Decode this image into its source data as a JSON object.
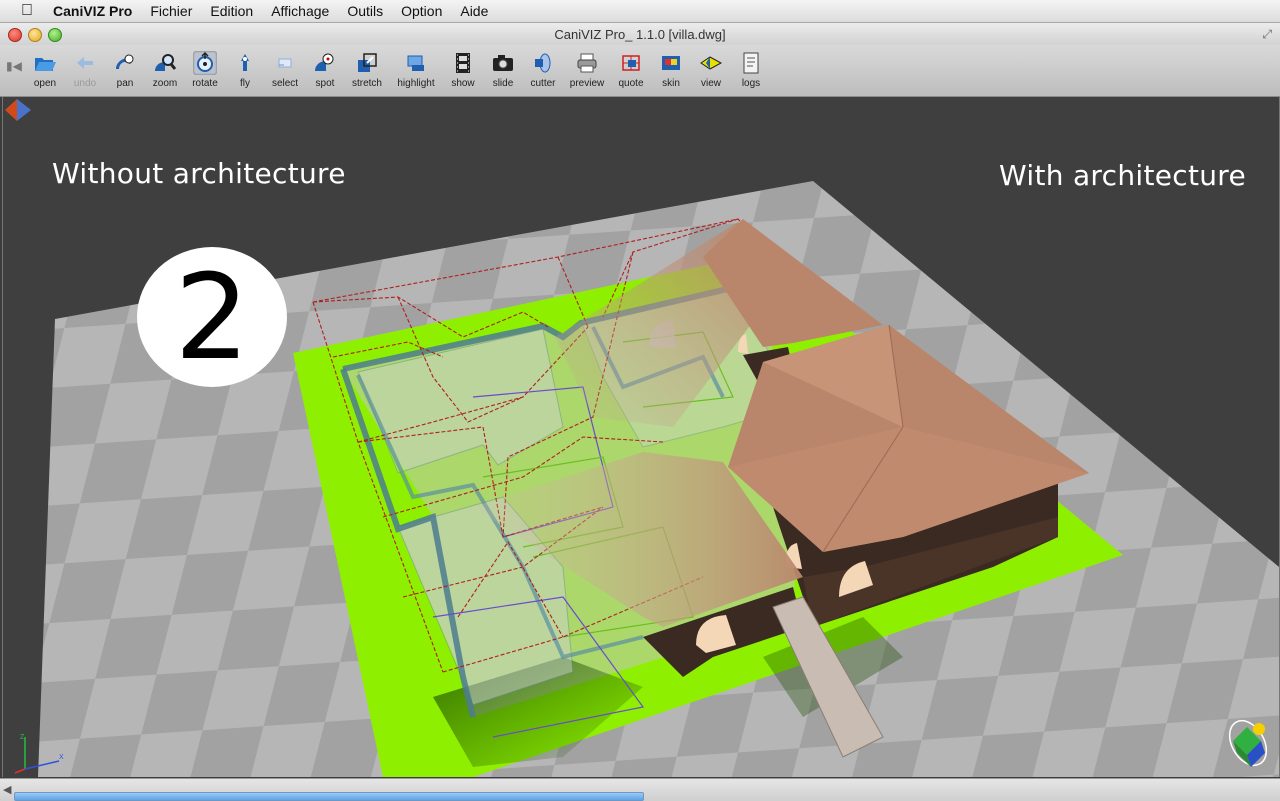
{
  "menubar": {
    "app_name": "CaniVIZ Pro",
    "items": [
      "Fichier",
      "Edition",
      "Affichage",
      "Outils",
      "Option",
      "Aide"
    ]
  },
  "window": {
    "title": "CaniVIZ Pro_ 1.1.0 [villa.dwg]"
  },
  "toolbar": {
    "buttons": [
      {
        "label": "open",
        "icon": "folder-open-icon",
        "enabled": true
      },
      {
        "label": "undo",
        "icon": "undo-arrow-icon",
        "enabled": false
      },
      {
        "label": "pan",
        "icon": "pan-hand-icon",
        "enabled": true
      },
      {
        "label": "zoom",
        "icon": "magnifier-icon",
        "enabled": true
      },
      {
        "label": "rotate",
        "icon": "rotate-icon",
        "enabled": true,
        "active": true
      },
      {
        "label": "fly",
        "icon": "fly-icon",
        "enabled": true
      },
      {
        "label": "select",
        "icon": "select-icon",
        "enabled": true
      },
      {
        "label": "spot",
        "icon": "spot-icon",
        "enabled": true
      },
      {
        "label": "stretch",
        "icon": "stretch-icon",
        "enabled": true
      },
      {
        "label": "highlight",
        "icon": "highlight-icon",
        "enabled": true
      },
      {
        "label": "show",
        "icon": "film-strip-icon",
        "enabled": true
      },
      {
        "label": "slide",
        "icon": "camera-icon",
        "enabled": true
      },
      {
        "label": "cutter",
        "icon": "cutter-icon",
        "enabled": true
      },
      {
        "label": "preview",
        "icon": "printer-icon",
        "enabled": true
      },
      {
        "label": "quote",
        "icon": "quote-icon",
        "enabled": true
      },
      {
        "label": "skin",
        "icon": "skin-icon",
        "enabled": true
      },
      {
        "label": "view",
        "icon": "view-icon",
        "enabled": true
      },
      {
        "label": "logs",
        "icon": "logs-icon",
        "enabled": true
      }
    ]
  },
  "viewport": {
    "left_caption": "Without architecture",
    "right_caption": "With architecture",
    "step_badge": "2",
    "colors": {
      "background": "#3f3f3f",
      "floor_light": "#b4b4b4",
      "floor_dark": "#9a9a9a",
      "lawn": "#8ef000",
      "roof": "#b9866b",
      "wall": "#3a2a22",
      "wireframe": "#b02020"
    }
  },
  "statusbar": {
    "progress": 0.5
  }
}
